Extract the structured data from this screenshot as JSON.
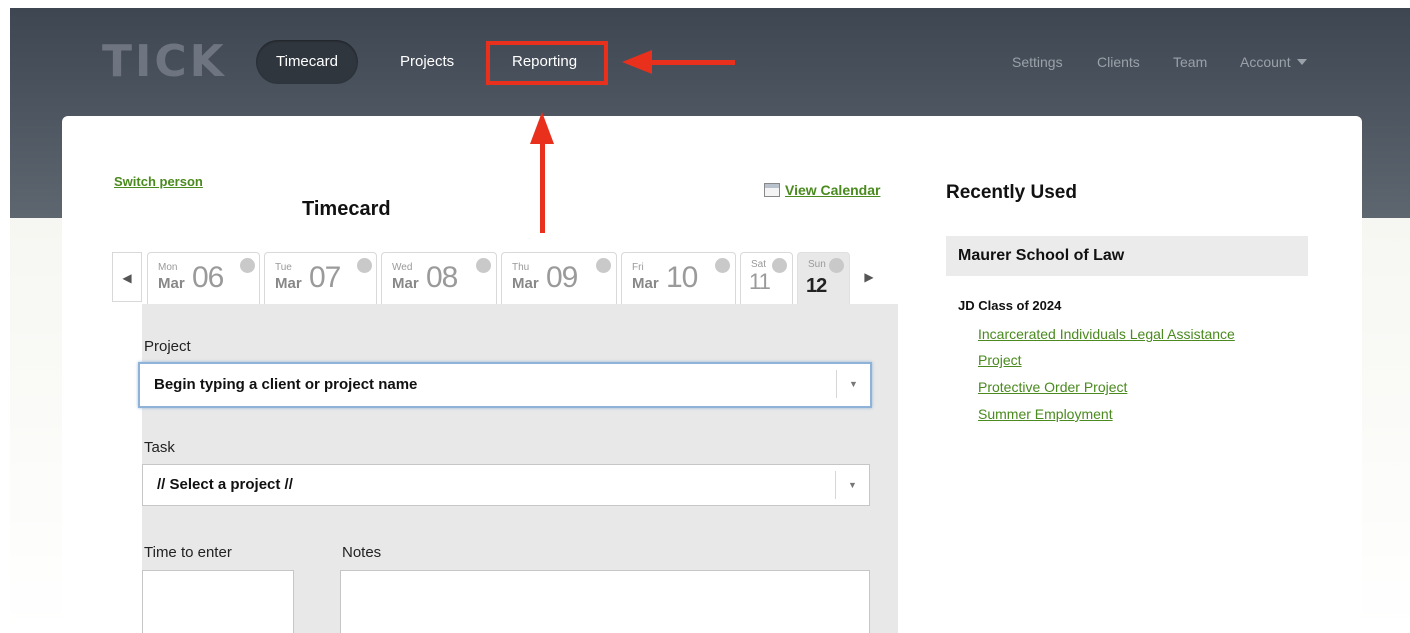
{
  "app": {
    "logo": "TICK"
  },
  "nav": {
    "primary": [
      {
        "label": "Timecard",
        "active": true
      },
      {
        "label": "Projects",
        "active": false
      },
      {
        "label": "Reporting",
        "active": false
      }
    ],
    "secondary": [
      "Settings",
      "Clients",
      "Team",
      "Account"
    ]
  },
  "timecard": {
    "switch_person": "Switch person",
    "title": "Timecard",
    "view_calendar": "View Calendar",
    "days": [
      {
        "dow": "Mon",
        "month": "Mar",
        "num": "06",
        "selected": false
      },
      {
        "dow": "Tue",
        "month": "Mar",
        "num": "07",
        "selected": false
      },
      {
        "dow": "Wed",
        "month": "Mar",
        "num": "08",
        "selected": false
      },
      {
        "dow": "Thu",
        "month": "Mar",
        "num": "09",
        "selected": false
      },
      {
        "dow": "Fri",
        "month": "Mar",
        "num": "10",
        "selected": false
      },
      {
        "dow": "Sat",
        "month": "",
        "num": "11",
        "selected": false
      },
      {
        "dow": "Sun",
        "month": "",
        "num": "12",
        "selected": true
      }
    ],
    "project_label": "Project",
    "project_placeholder": "Begin typing a client or project name",
    "task_label": "Task",
    "task_value": "// Select a project //",
    "time_label": "Time to enter",
    "notes_label": "Notes"
  },
  "recently_used": {
    "title": "Recently Used",
    "client": "Maurer School of Law",
    "group": "JD Class of 2024",
    "links": [
      "Incarcerated Individuals Legal Assistance",
      "Project",
      "Protective Order Project",
      "Summer Employment"
    ]
  },
  "colors": {
    "accent_green": "#4a8a1e",
    "annotation_red": "#e8301c",
    "header_dark": "#3e4652"
  }
}
